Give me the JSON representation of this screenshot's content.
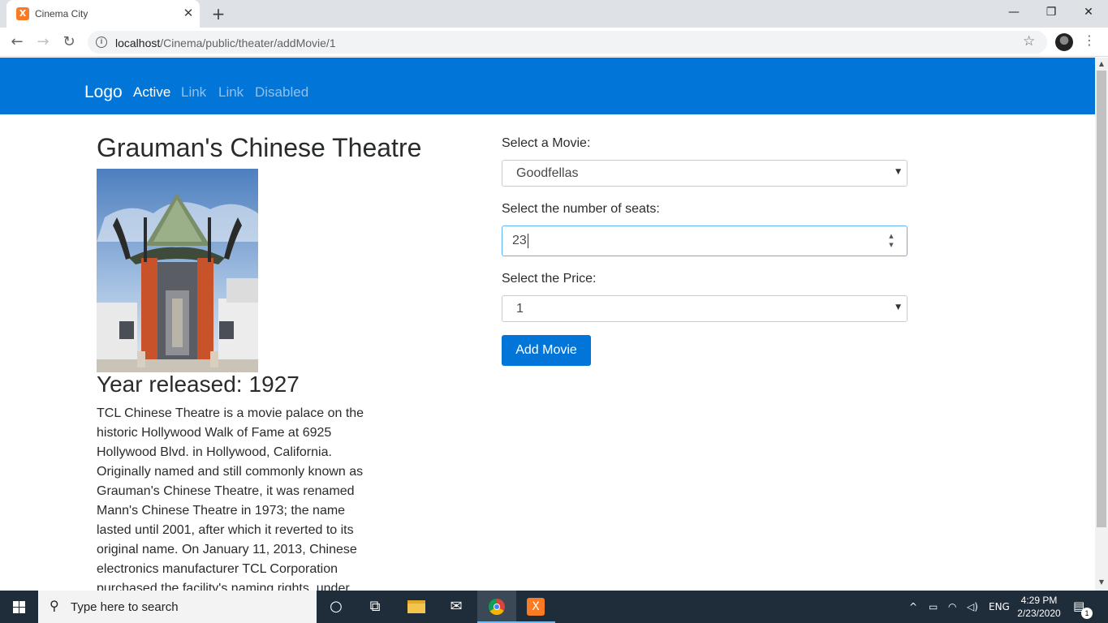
{
  "browser": {
    "tab_title": "Cinema City",
    "tab_close": "✕",
    "new_tab": "+",
    "url_host": "localhost",
    "url_path": "/Cinema/public/theater/addMovie/1",
    "window_controls": {
      "minimize": "—",
      "restore": "❐",
      "close": "✕"
    }
  },
  "navbar": {
    "logo": "Logo",
    "links": [
      "Active",
      "Link",
      "Link",
      "Disabled"
    ]
  },
  "theater": {
    "name": "Grauman's Chinese Theatre",
    "year_label": "Year released:",
    "year": "1927",
    "description": "TCL Chinese Theatre is a movie palace on the historic Hollywood Walk of Fame at 6925 Hollywood Blvd. in Hollywood, California. Originally named and still commonly known as Grauman's Chinese Theatre, it was renamed Mann's Chinese Theatre in 1973; the name lasted until 2001, after which it reverted to its original name. On January 11, 2013, Chinese electronics manufacturer TCL Corporation purchased the facility's naming rights, under"
  },
  "form": {
    "movie_label": "Select a Movie:",
    "movie_value": "Goodfellas",
    "seats_label": "Select the number of seats:",
    "seats_value": "23",
    "price_label": "Select the Price:",
    "price_value": "1",
    "submit_label": "Add Movie"
  },
  "taskbar": {
    "search_placeholder": "Type here to search",
    "language": "ENG",
    "time": "4:29 PM",
    "date": "2/23/2020",
    "notification_count": "1"
  },
  "colors": {
    "brand_blue": "#0275d8",
    "taskbar": "#1f2c39",
    "xampp_orange": "#fb7a24"
  }
}
